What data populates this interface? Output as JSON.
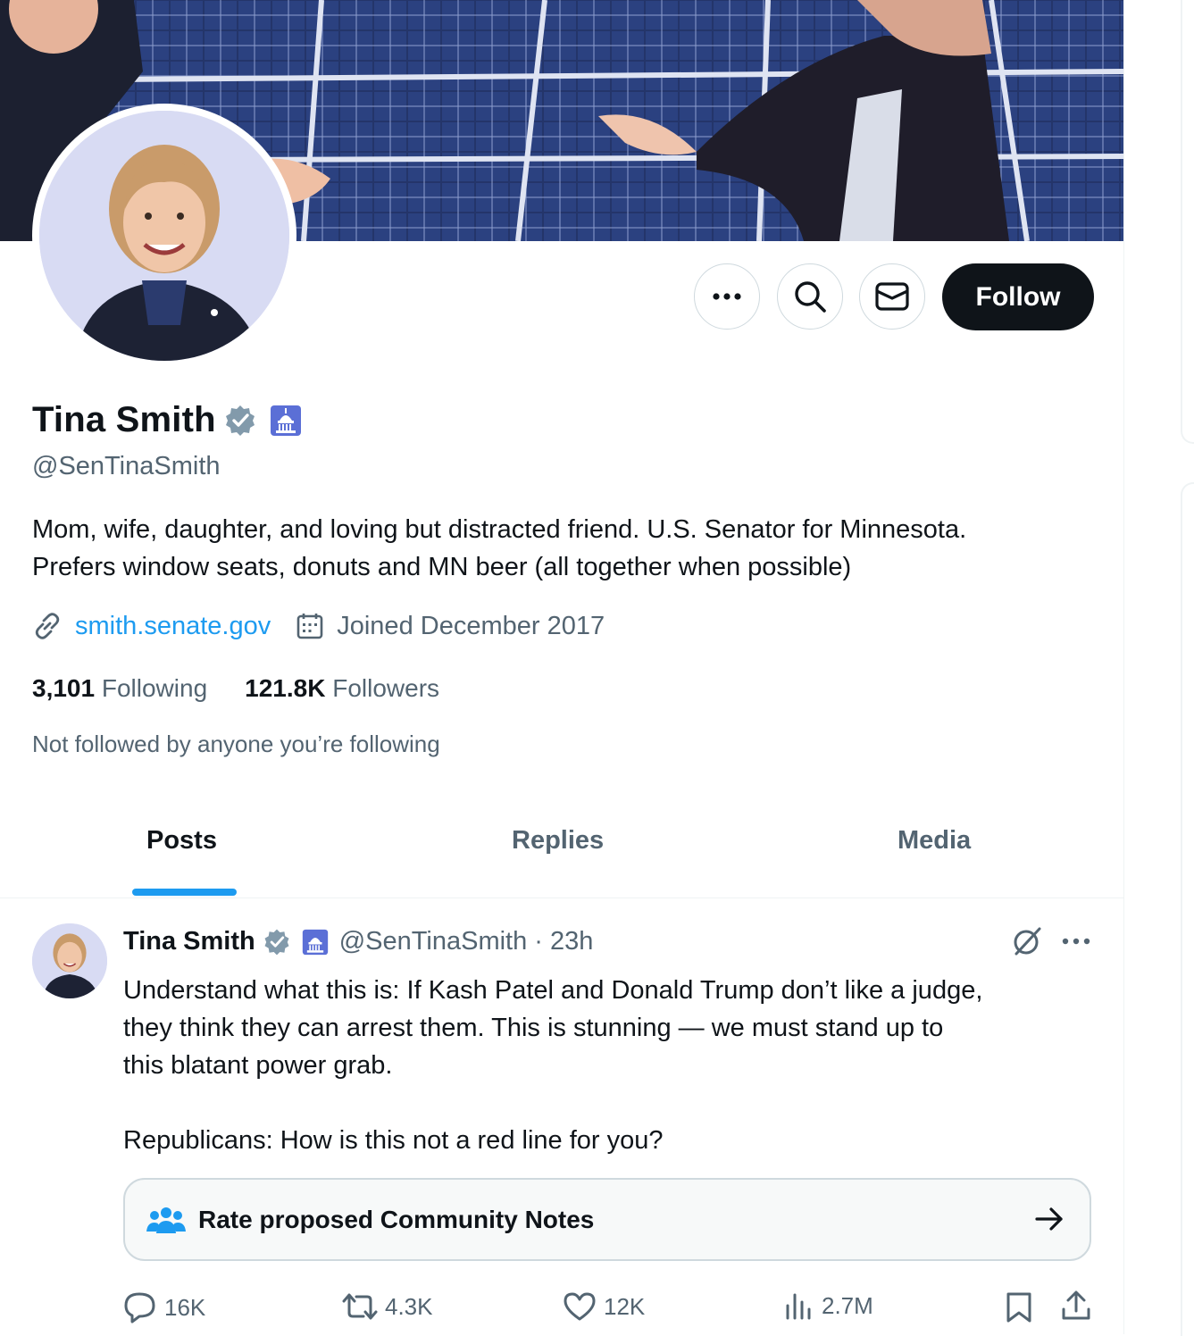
{
  "profile": {
    "name": "Tina Smith",
    "handle": "@SenTinaSmith",
    "bio_line1": "Mom, wife, daughter, and loving but distracted friend. U.S. Senator for Minnesota.",
    "bio_line2": "Prefers window seats, donuts and MN beer (all together when possible)",
    "website": "smith.senate.gov",
    "joined": "Joined December 2017",
    "following_count": "3,101",
    "following_label": "Following",
    "followers_count": "121.8K",
    "followers_label": "Followers",
    "not_followed": "Not followed by anyone you’re following"
  },
  "actions": {
    "follow_label": "Follow",
    "more_icon": "more-icon",
    "search_icon": "search-icon",
    "message_icon": "mail-icon"
  },
  "tabs": [
    {
      "label": "Posts",
      "active": true
    },
    {
      "label": "Replies",
      "active": false
    },
    {
      "label": "Media",
      "active": false
    }
  ],
  "post": {
    "author": "Tina Smith",
    "handle_time": "@SenTinaSmith · 23h",
    "line1": "Understand what this is: If Kash Patel and Donald Trump don’t like a judge,",
    "line2": "they think they can arrest them. This is stunning — we must stand up to",
    "line3": "this blatant power grab.",
    "line4": "Republicans: How is this not a red line for you?",
    "community_note": "Rate proposed Community Notes",
    "stats": {
      "replies": "16K",
      "reposts": "4.3K",
      "likes": "12K",
      "views": "2.7M"
    }
  },
  "colors": {
    "accent": "#1d9bf0",
    "text": "#0f1419",
    "muted": "#536471",
    "verified": "#829aab"
  }
}
